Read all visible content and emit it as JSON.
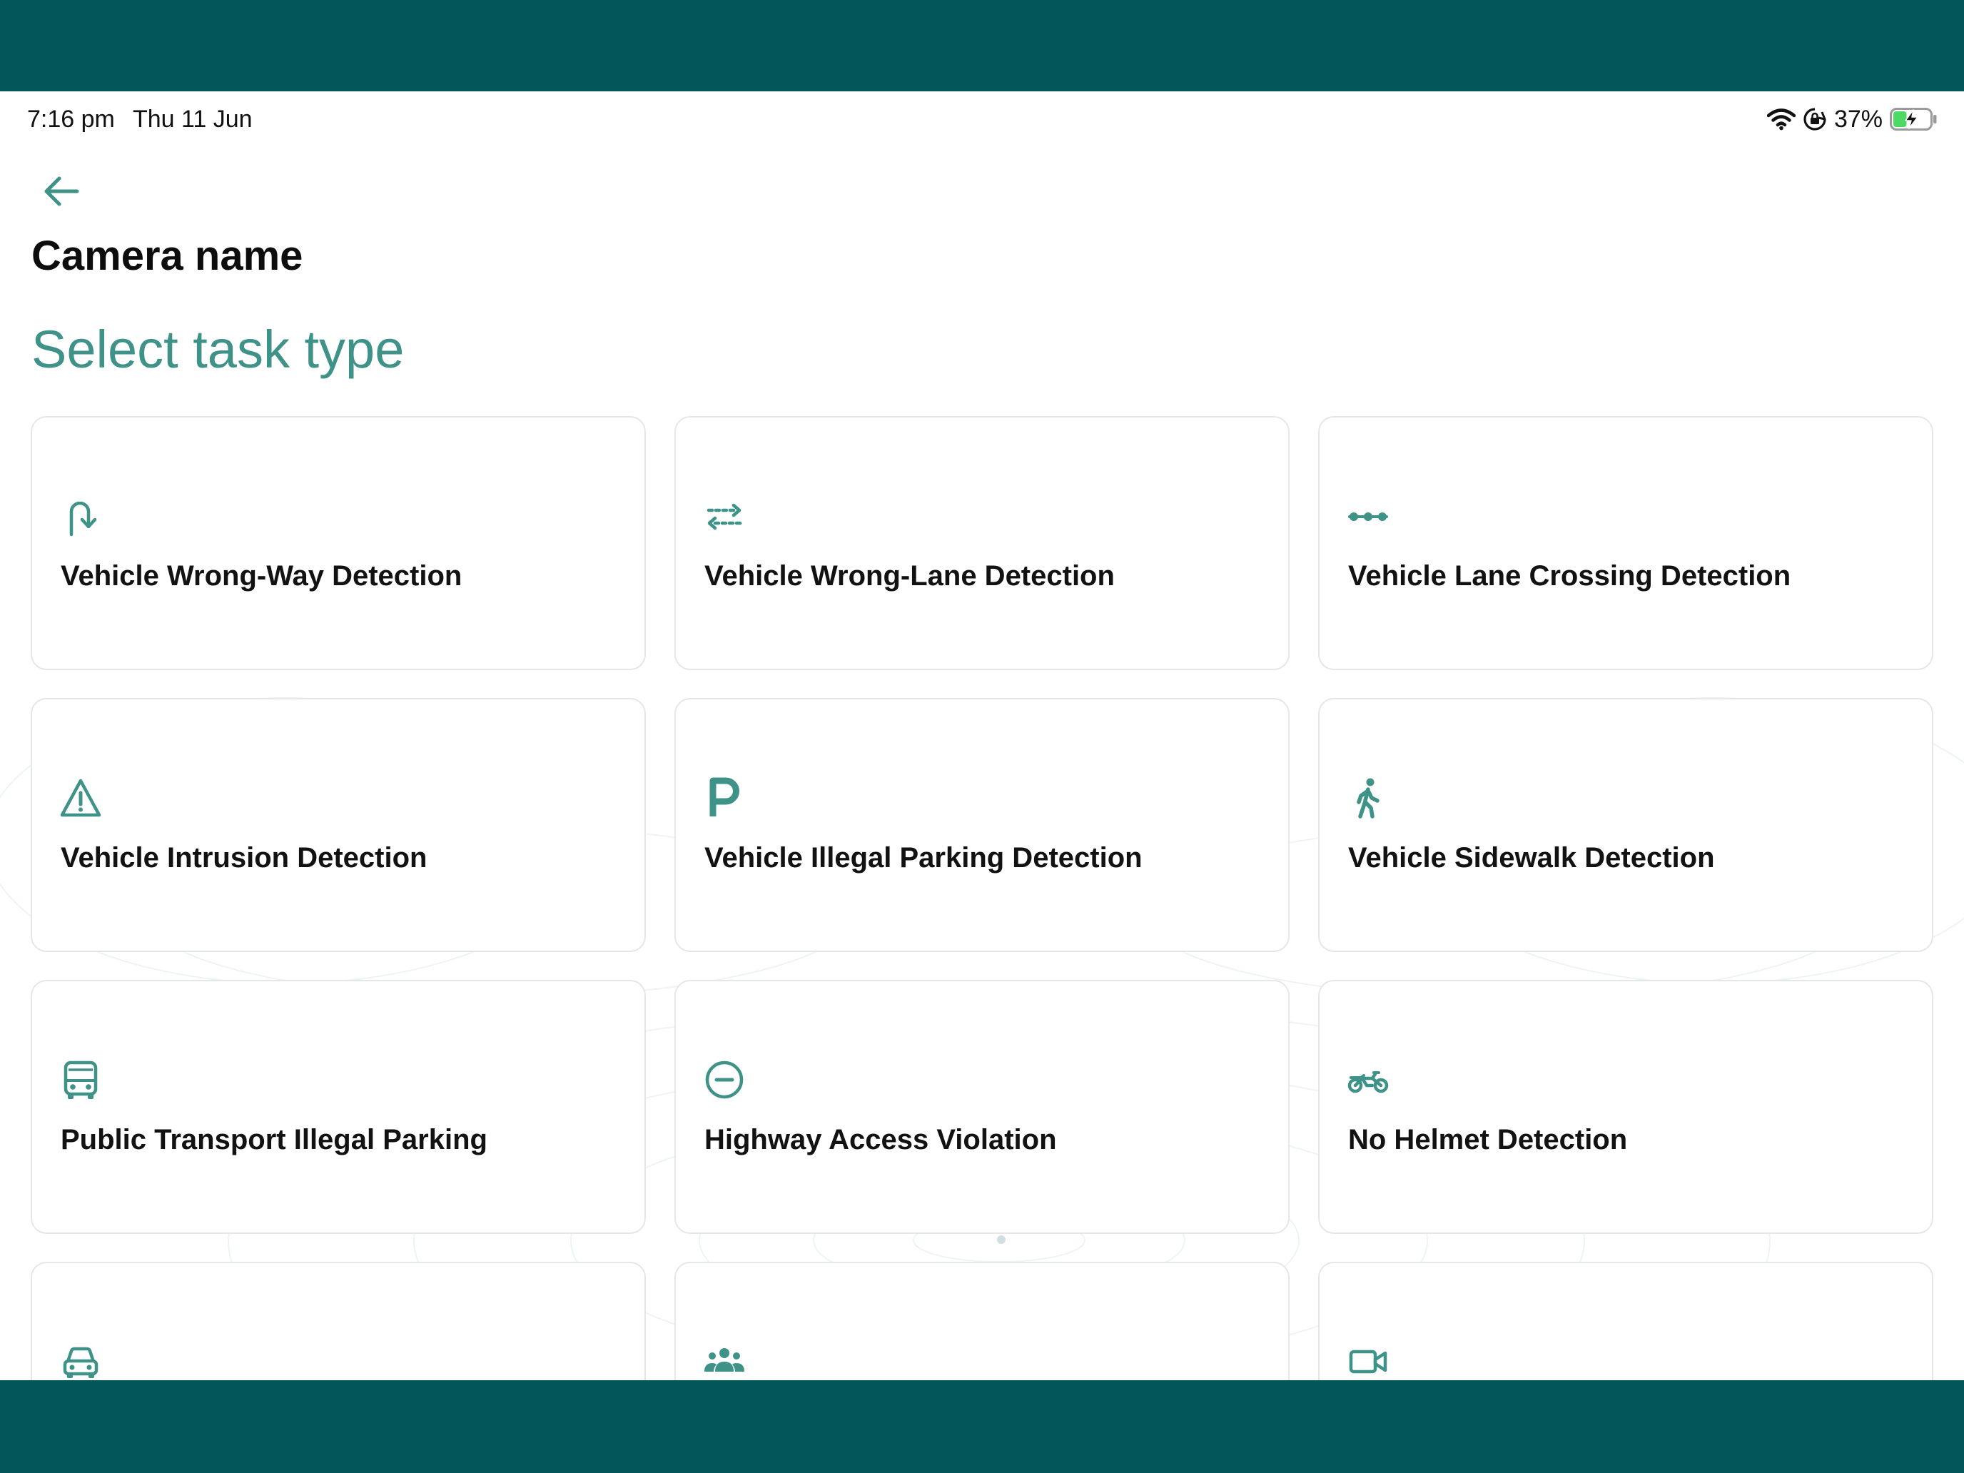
{
  "status_bar": {
    "time": "7:16 pm",
    "date": "Thu 11 Jun",
    "battery": "37%",
    "battery_level": 0.37,
    "icons": [
      "wifi-icon",
      "orientation-lock-icon",
      "battery-charging-icon"
    ]
  },
  "header": {
    "back_icon": "arrow-left-icon",
    "title": "Camera name",
    "subtitle": "Select task type"
  },
  "colors": {
    "accent": "#3f9287",
    "frame": "#02575a",
    "card_border": "#e4e7e8",
    "text": "#121212"
  },
  "tasks": [
    {
      "label": "Vehicle Wrong-Way Detection",
      "icon": "u-turn-icon"
    },
    {
      "label": "Vehicle Wrong-Lane Detection",
      "icon": "lane-switch-arrows-icon"
    },
    {
      "label": "Vehicle Lane Crossing Detection",
      "icon": "dots-line-icon"
    },
    {
      "label": "Vehicle Intrusion Detection",
      "icon": "warning-triangle-icon"
    },
    {
      "label": "Vehicle Illegal Parking Detection",
      "icon": "parking-p-icon"
    },
    {
      "label": "Vehicle Sidewalk Detection",
      "icon": "pedestrian-walk-icon"
    },
    {
      "label": "Public Transport Illegal Parking",
      "icon": "bus-icon"
    },
    {
      "label": "Highway Access Violation",
      "icon": "no-entry-circle-icon"
    },
    {
      "label": "No Helmet Detection",
      "icon": "motorcycle-icon"
    },
    {
      "label": "",
      "icon": "car-icon"
    },
    {
      "label": "",
      "icon": "people-group-icon"
    },
    {
      "label": "",
      "icon": "video-camera-icon"
    }
  ]
}
